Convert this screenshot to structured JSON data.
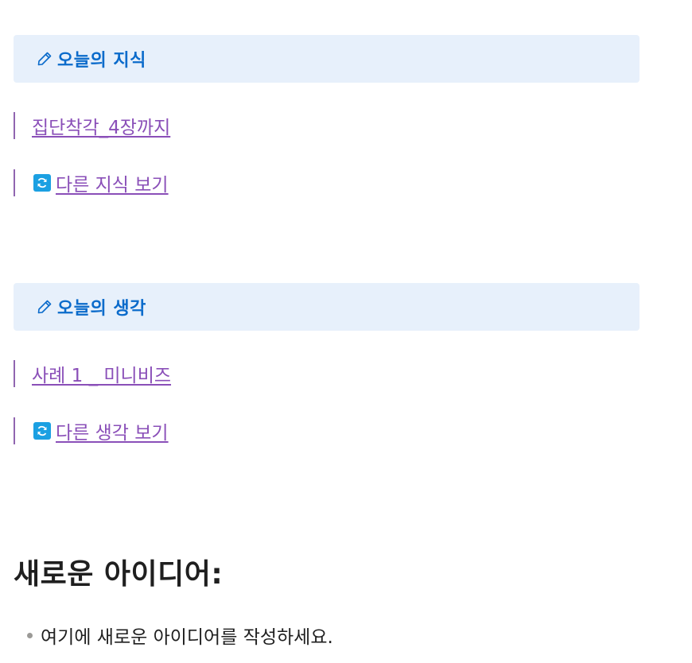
{
  "knowledge": {
    "title": "오늘의 지식",
    "link": "집단착각_4장까지",
    "more": "다른 지식 보기"
  },
  "thought": {
    "title": "오늘의 생각",
    "link": "사례 1 _ 미니비즈",
    "more": "다른 생각 보기"
  },
  "ideas": {
    "heading": "새로운 아이디어:",
    "items": [
      "여기에 새로운 아이디어를 작성하세요."
    ]
  },
  "colors": {
    "callout_bg": "#e7f0fb",
    "callout_text": "#0b6bcb",
    "link": "#8a4fb8",
    "refresh_icon": "#1ba0e2"
  },
  "icons": [
    "pencil-icon",
    "refresh-icon"
  ]
}
